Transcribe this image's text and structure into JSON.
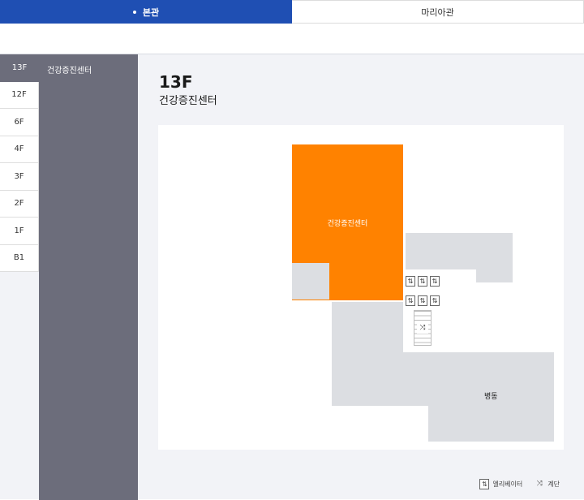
{
  "building_tabs": [
    {
      "label": "본관",
      "active": true
    },
    {
      "label": "마리아관",
      "active": false
    }
  ],
  "floors": [
    "13F",
    "12F",
    "6F",
    "4F",
    "3F",
    "2F",
    "1F",
    "B1"
  ],
  "active_floor": "13F",
  "departments": [
    "건강증진센터"
  ],
  "floor_view": {
    "title": "13F",
    "subtitle": "건강증진센터",
    "map_labels": {
      "highlight": "건강증진센터",
      "ward": "병동"
    }
  },
  "legend": {
    "elevator": "엘리베이터",
    "stairs": "계단"
  },
  "colors": {
    "accent_blue": "#1f4fb3",
    "highlight_orange": "#ff8200",
    "panel_gray": "#6c6d7b",
    "room_gray": "#dcdee2"
  },
  "icons": {
    "elevator": "elevator-icon",
    "stairs": "stairs-icon"
  }
}
